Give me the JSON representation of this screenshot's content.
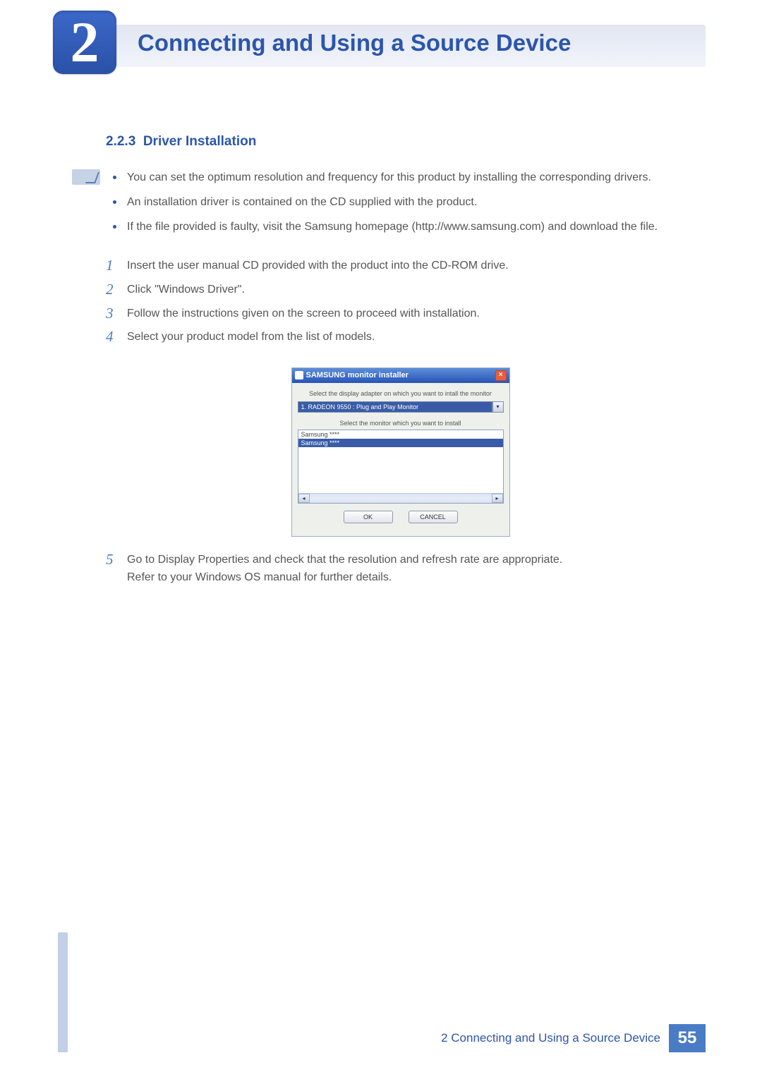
{
  "header": {
    "chapter_number": "2",
    "chapter_title": "Connecting and Using a Source Device"
  },
  "section": {
    "number": "2.2.3",
    "title": "Driver Installation"
  },
  "notes": [
    "You can set the optimum resolution and frequency for this product by installing the corresponding drivers.",
    "An installation driver is contained on the CD supplied with the product.",
    "If the file provided is faulty, visit the Samsung homepage (http://www.samsung.com) and download the file."
  ],
  "steps": {
    "1": "Insert the user manual CD provided with the product into the CD-ROM drive.",
    "2": "Click \"Windows Driver\".",
    "3": "Follow the instructions given on the screen to proceed with installation.",
    "4": "Select your product model from the list of models.",
    "5a": "Go to Display Properties and check that the resolution and refresh rate are appropriate.",
    "5b": "Refer to your Windows OS manual for further details."
  },
  "dialog": {
    "title": "SAMSUNG monitor installer",
    "label_adapter": "Select the display adapter on which you want to intall the monitor",
    "adapter_value": "1. RADEON 9550 : Plug and Play Monitor",
    "label_monitor": "Select the monitor which you want to install",
    "list_item1": "Samsung ****",
    "list_item2": "Samsung ****",
    "btn_ok": "OK",
    "btn_cancel": "CANCEL"
  },
  "footer": {
    "text": "2 Connecting and Using a Source Device",
    "page": "55"
  }
}
